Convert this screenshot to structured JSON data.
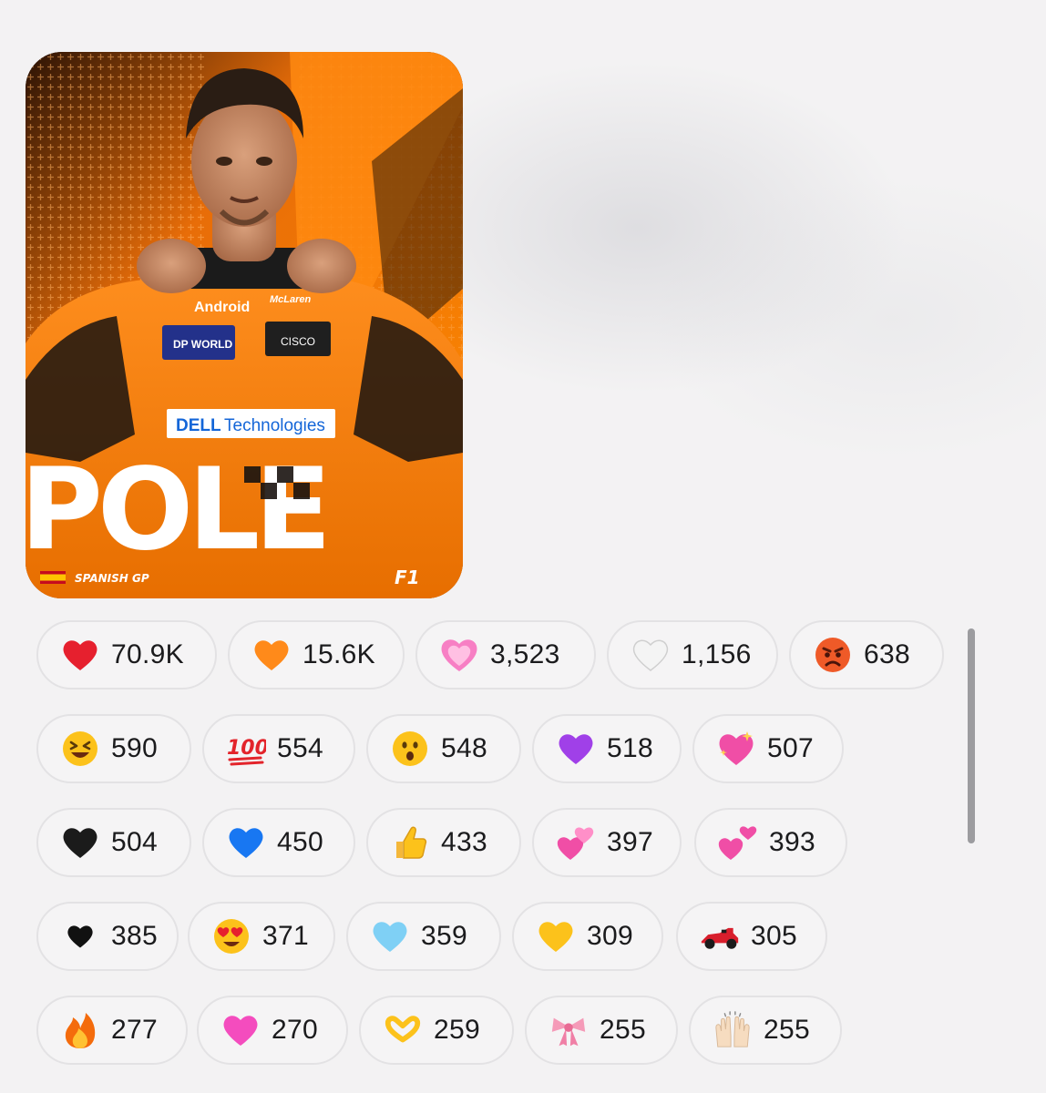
{
  "image": {
    "title": "POLE",
    "race": "SPANISH GP",
    "brand": "F1",
    "sponsors": [
      "Android",
      "McLaren",
      "DP WORLD",
      "CISCO",
      "DELL Technologies"
    ]
  },
  "reactions": [
    {
      "icon": "red-heart-icon",
      "count": "70.9K"
    },
    {
      "icon": "orange-heart-icon",
      "count": "15.6K"
    },
    {
      "icon": "growing-heart-icon",
      "count": "3,523"
    },
    {
      "icon": "white-heart-icon",
      "count": "1,156"
    },
    {
      "icon": "angry-face-icon",
      "count": "638"
    },
    {
      "icon": "laughing-face-icon",
      "count": "590"
    },
    {
      "icon": "hundred-points-icon",
      "count": "554"
    },
    {
      "icon": "surprised-face-icon",
      "count": "548"
    },
    {
      "icon": "purple-heart-icon",
      "count": "518"
    },
    {
      "icon": "sparkling-heart-icon",
      "count": "507"
    },
    {
      "icon": "black-heart-icon",
      "count": "504"
    },
    {
      "icon": "blue-heart-icon",
      "count": "450"
    },
    {
      "icon": "thumbs-up-icon",
      "count": "433"
    },
    {
      "icon": "two-hearts-icon",
      "count": "397"
    },
    {
      "icon": "revolving-hearts-icon",
      "count": "393"
    },
    {
      "icon": "black-heart-suit-icon",
      "count": "385"
    },
    {
      "icon": "heart-eyes-face-icon",
      "count": "371"
    },
    {
      "icon": "light-blue-heart-icon",
      "count": "359"
    },
    {
      "icon": "yellow-heart-icon",
      "count": "309"
    },
    {
      "icon": "racing-car-icon",
      "count": "305"
    },
    {
      "icon": "fire-icon",
      "count": "277"
    },
    {
      "icon": "pink-heart-icon",
      "count": "270"
    },
    {
      "icon": "heart-hands-icon",
      "count": "259"
    },
    {
      "icon": "ribbon-icon",
      "count": "255"
    },
    {
      "icon": "raising-hands-icon",
      "count": "255"
    }
  ]
}
